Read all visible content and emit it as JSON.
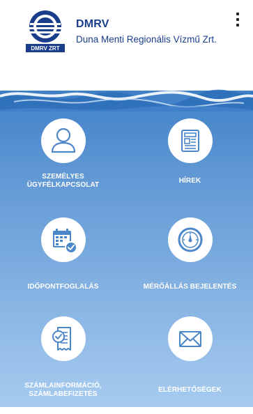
{
  "header": {
    "brand_name": "DMRV",
    "brand_subtitle": "Duna Menti Regionális Vízmű Zrt.",
    "logo_badge": "DMRV ZRT",
    "menu_icon": "more-vertical-icon"
  },
  "colors": {
    "brand_blue": "#1a3e8c",
    "water_top": "#5f97d4",
    "water_bottom": "#a7cbef",
    "tile_circle": "#ffffff",
    "icon_blue": "#4a86c8",
    "label_text": "#ffffff"
  },
  "tiles": [
    {
      "label_line1": "SZEMÉLYES",
      "label_line2": "ÜGYFÉLKAPCSOLAT",
      "icon": "person-icon"
    },
    {
      "label_line1": "HÍREK",
      "label_line2": "",
      "icon": "newspaper-icon"
    },
    {
      "label_line1": "IDŐPONTFOGLALÁS",
      "label_line2": "",
      "icon": "calendar-check-icon"
    },
    {
      "label_line1": "MÉRŐÁLLÁS BEJELENTÉS",
      "label_line2": "",
      "icon": "meter-gauge-icon"
    },
    {
      "label_line1": "SZÁMLAINFORMÁCIÓ,",
      "label_line2": "SZÁMLABEFIZETÉS",
      "icon": "invoice-icon"
    },
    {
      "label_line1": "ELÉRHETŐSÉGEK",
      "label_line2": "",
      "icon": "envelope-icon"
    }
  ]
}
